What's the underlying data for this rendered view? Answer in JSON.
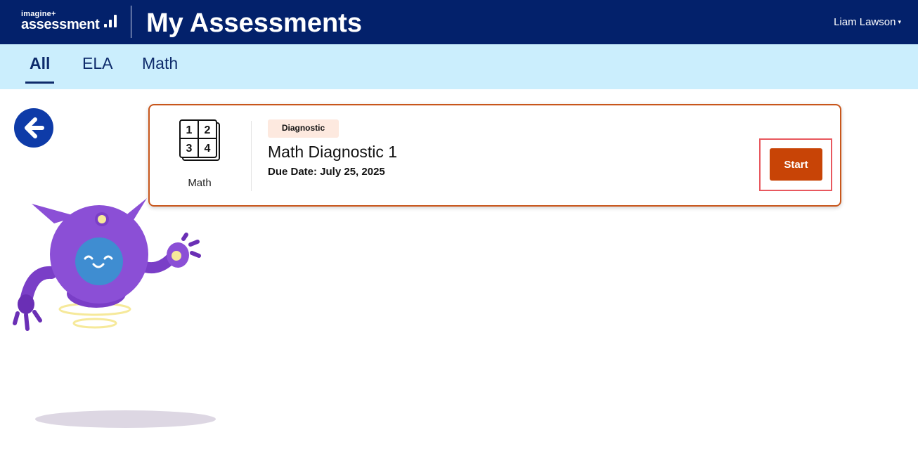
{
  "header": {
    "logo_small": "imagine+",
    "logo_big": "assessment",
    "title": "My Assessments",
    "user_name": "Liam Lawson",
    "user_caret": "▾"
  },
  "tabs": [
    {
      "label": "All",
      "active": true
    },
    {
      "label": "ELA",
      "active": false
    },
    {
      "label": "Math",
      "active": false
    }
  ],
  "card": {
    "subject_label": "Math",
    "subject_icon": "math-book-icon",
    "subject_icon_digits": [
      "1",
      "2",
      "3",
      "4"
    ],
    "badge": "Diagnostic",
    "title": "Math Diagnostic 1",
    "due_date": "Due Date: July 25, 2025",
    "start_label": "Start"
  },
  "colors": {
    "header_bg": "#03216b",
    "tabs_bg": "#cbeefd",
    "accent": "#c84406",
    "card_border": "#c8561b",
    "badge_bg": "#fde9df",
    "back_button": "#0e3ba8",
    "mascot_body": "#8b4fd6",
    "mascot_face": "#3f8dd1"
  },
  "icons": {
    "back": "arrow-left-icon",
    "mascot": "robot-mascot"
  }
}
